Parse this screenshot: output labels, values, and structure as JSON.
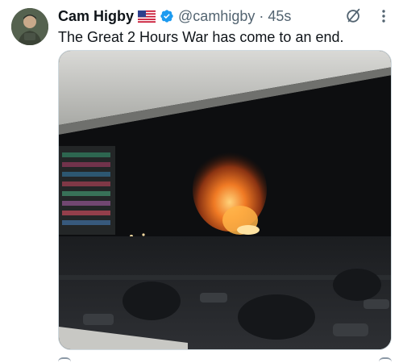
{
  "author": {
    "display_name": "Cam Higby",
    "flag_icon": "us-flag-icon",
    "verified_icon": "verified-badge-icon",
    "verified_color": "#1d9bf0",
    "handle": "@camhigby",
    "separator": "·",
    "time_ago": "45s"
  },
  "tweet": {
    "text": "The Great 2 Hours War has come to an end."
  },
  "toolbar": {
    "grok_icon": "grok-icon",
    "more_icon": "more-vertical-icon"
  },
  "media": {
    "description_icon": "video-thumbnail"
  },
  "colors": {
    "text_primary": "#0f1419",
    "text_secondary": "#536471",
    "border": "#cfd9de",
    "accent": "#1d9bf0"
  }
}
